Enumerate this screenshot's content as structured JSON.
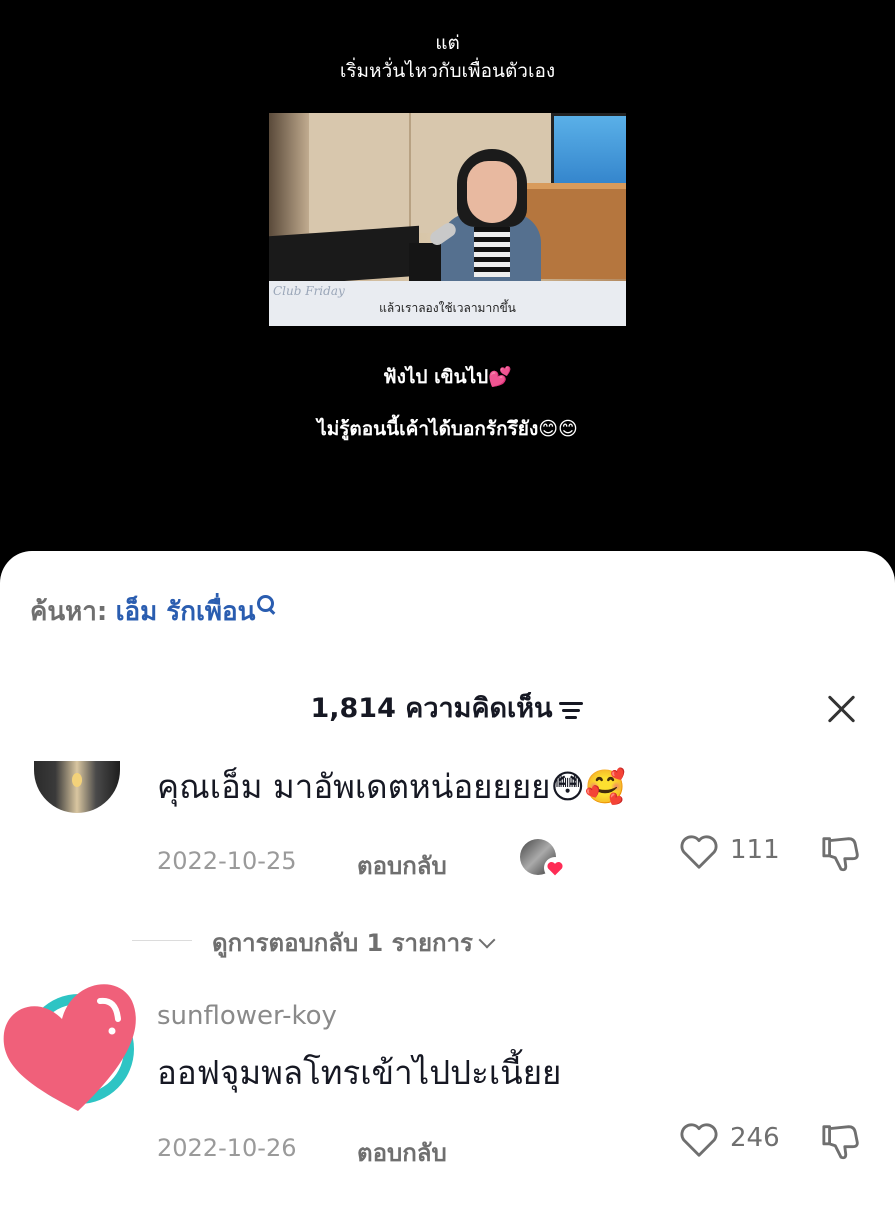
{
  "video": {
    "caption_line1": "แต่",
    "caption_line2": "เริ่มหวั่นไหวกับเพื่อนตัวเอง",
    "frame_logo": "Club Friday",
    "frame_subtitle": "แล้วเราลองใช้เวลามากขึ้น",
    "caption_line3": "ฟังไป เขินไป💕",
    "caption_line4": "ไม่รู้ตอนนี้เค้าได้บอกรักรึยัง😊😊"
  },
  "search": {
    "prefix": "ค้นหา:",
    "term": "เอ็ม รักเพื่อน",
    "icon": "search-icon"
  },
  "comments_panel": {
    "count_label": "1,814 ความคิดเห็น",
    "sort_icon": "sort-icon",
    "close_icon": "close-icon"
  },
  "comments": [
    {
      "text": "คุณเอ็ม มาอัพเดตหน่อยยยย😳🥰",
      "date": "2022-10-25",
      "reply_label": "ตอบกลับ",
      "likes": "111",
      "liked_by_creator": true
    },
    {
      "username": "sunflower-koy",
      "text": "ออฟจุมพลโทรเข้าไปปะเนี้ยย",
      "date": "2022-10-26",
      "reply_label": "ตอบกลับ",
      "likes": "246"
    }
  ],
  "view_replies_label": "ดูการตอบกลับ 1 รายการ",
  "colors": {
    "sheet_bg": "#ffffff",
    "search_term": "#2a5db0",
    "heart_pink": "#f0607a",
    "avatar_ring": "#2ec4c4"
  }
}
